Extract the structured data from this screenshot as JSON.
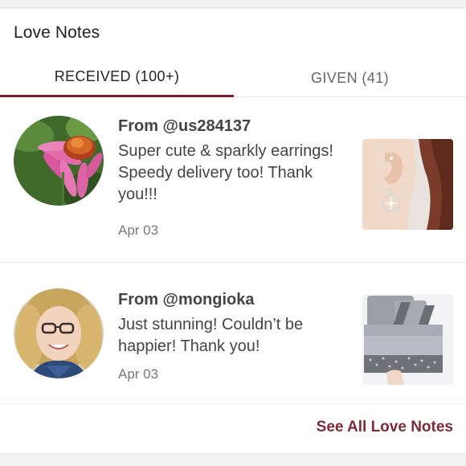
{
  "section": {
    "title": "Love Notes"
  },
  "tabs": [
    {
      "label": "RECEIVED (100+)",
      "active": true
    },
    {
      "label": "GIVEN (41)",
      "active": false
    }
  ],
  "notes": [
    {
      "from": "From @us284137",
      "text": "Super cute & sparkly earrings! Speedy delivery too! Thank you!!!",
      "date": "Apr 03",
      "avatar_icon": "flower-avatar",
      "thumb_icon": "earring-photo"
    },
    {
      "from": "From @mongioka",
      "text": "Just stunning! Couldn’t be happier! Thank you!",
      "date": "Apr 03",
      "avatar_icon": "person-avatar",
      "thumb_icon": "clutch-photo"
    }
  ],
  "footer": {
    "see_all_label": "See All Love Notes"
  },
  "colors": {
    "accent": "#7d1f31",
    "link": "#7d2a3a"
  }
}
